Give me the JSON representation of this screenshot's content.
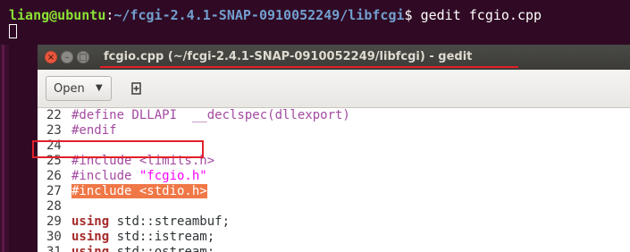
{
  "terminal": {
    "user_host": "liang@ubuntu",
    "path": "~/fcgi-2.4.1-SNAP-0910052249/libfcgi",
    "command": "$ gedit fcgio.cpp"
  },
  "window": {
    "title": "fcgio.cpp (~/fcgi-2.4.1-SNAP-0910052249/libfcgi) - gedit",
    "close_glyph": "×",
    "minimize_glyph": "–",
    "maximize_glyph": "□"
  },
  "toolbar": {
    "open_label": "Open",
    "open_arrow": "▼",
    "new_document_icon": "new-document-icon"
  },
  "editor": {
    "lines": [
      {
        "num": "22",
        "a": "#define DLLAPI  __declspec(dllexport)"
      },
      {
        "num": "23",
        "a": "#endif"
      },
      {
        "num": "24",
        "a": ""
      },
      {
        "num": "25",
        "a": "#include <limits.h>"
      },
      {
        "num": "26",
        "a": "#include ",
        "b": "\"fcgio.h\""
      },
      {
        "num": "27",
        "a": "#include <stdio.h>"
      },
      {
        "num": "28",
        "a": ""
      },
      {
        "num": "29",
        "a": "using",
        "b": " std::streambuf;"
      },
      {
        "num": "30",
        "a": "using",
        "b": " std::istream;"
      },
      {
        "num": "31",
        "a": "using",
        "b": " std::ostream;"
      }
    ]
  },
  "colors": {
    "annotation": "#e2202a",
    "selection": "#f07746",
    "terminal_bg": "#300a24"
  }
}
